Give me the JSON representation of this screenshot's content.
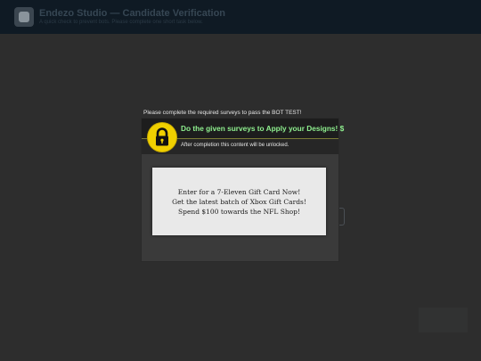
{
  "app": {
    "title": "Endezo Studio — Candidate Verification",
    "subtitle": "A quick check to prevent bots. Please complete one short task below."
  },
  "prompt": "Please complete the required surveys to pass the BOT TEST!",
  "locker": {
    "header_title": "Do the given surveys to Apply your Designs! $",
    "subheader_text": "After completion this content will be unlocked.",
    "icon": "padlock-icon",
    "accent_color": "#f0d000",
    "title_color": "#8ff08f"
  },
  "offers": [
    {
      "label": "Enter for a 7-Eleven Gift Card Now!"
    },
    {
      "label": "Get the latest batch of Xbox Gift Cards!"
    },
    {
      "label": "Spend $100 towards the NFL Shop!"
    }
  ]
}
